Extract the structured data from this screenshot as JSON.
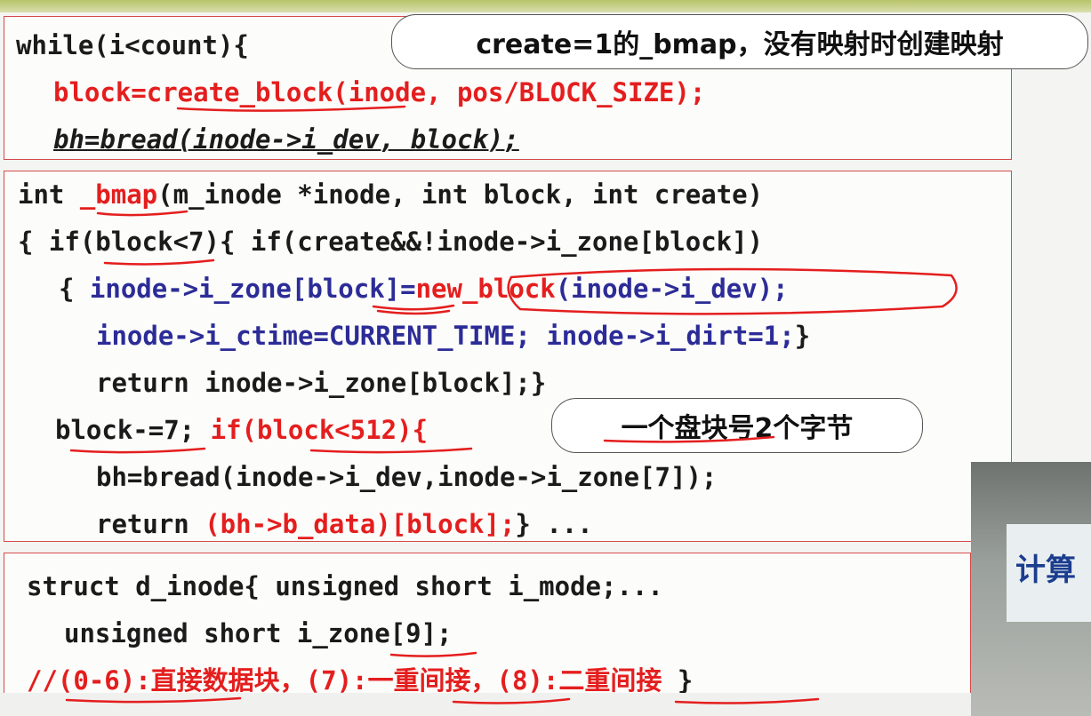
{
  "box1": {
    "line1": "while(i<count){",
    "line2": "block=create_block(inode, pos/BLOCK_SIZE);",
    "line3": "bh=bread(inode->i_dev, block);"
  },
  "callout1": "create=1的_bmap，没有映射时创建映射",
  "box2": {
    "line1_a": "int ",
    "line1_b": "_bmap",
    "line1_c": "(m_inode *inode, int block, int create)",
    "line2": "{ if(block<7){ if(create&&!inode->i_zone[block])",
    "line3_a": "{ ",
    "line3_b": "inode->i_zone[block]=",
    "line3_c": "new_block",
    "line3_d": "(inode->i_dev);",
    "line4_a": "inode->i_ctime=CURRENT_TIME; inode->i_dirt=1;",
    "line4_b": "}",
    "line5": "return inode->i_zone[block];}",
    "line6_a": "block-=7; ",
    "line6_b": "if(block<512){",
    "line7": "bh=bread(inode->i_dev,inode->i_zone[7]);",
    "line8_a": "return ",
    "line8_b": "(bh->b_data)[block];",
    "line8_c": "} ..."
  },
  "callout2": "一个盘块号2个字节",
  "box3": {
    "line1": "struct d_inode{ unsigned short i_mode;...",
    "line2": "unsigned short i_zone[9];",
    "line3_a": "//(0-6):直接数据块，(7):一重间接，(8):二重间接",
    "line3_b": " }"
  },
  "sidepanel": {
    "sign_text": "计算"
  },
  "colors": {
    "code_red": "#e41e1e",
    "code_blue": "#2c2c98",
    "box_border": "#d34b4b",
    "ink": "#e41e1e"
  }
}
